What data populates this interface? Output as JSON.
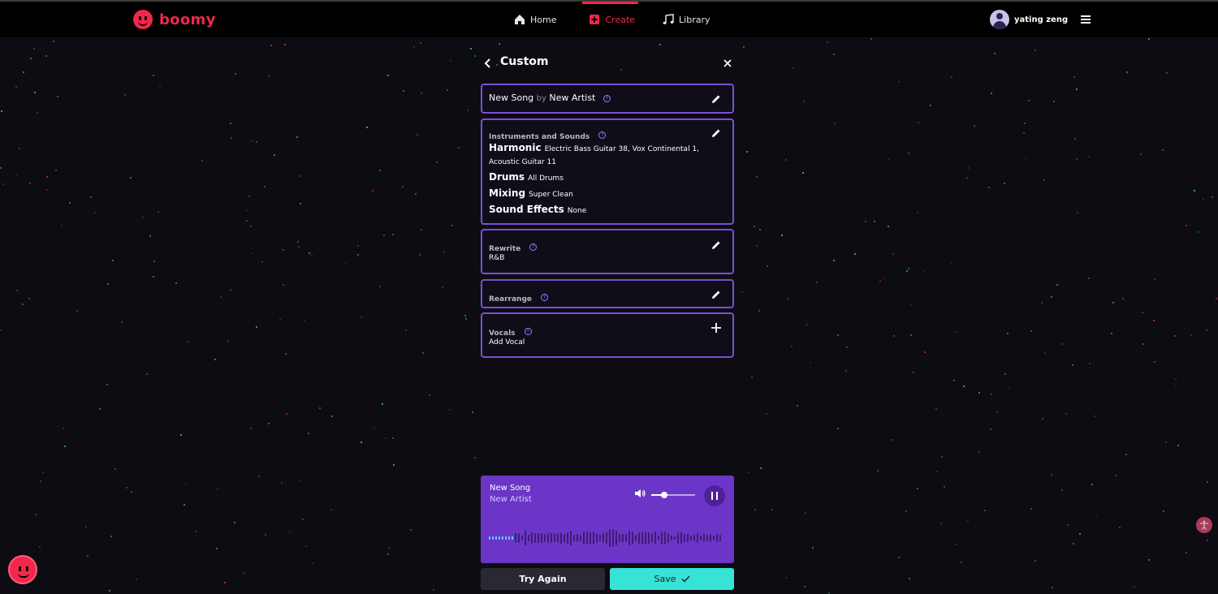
{
  "brand": {
    "name": "boomy",
    "accent": "#f0284a"
  },
  "nav": {
    "home": "Home",
    "create": "Create",
    "library": "Library"
  },
  "user": {
    "name": "yating zeng"
  },
  "panel": {
    "title": "Custom",
    "song": {
      "title": "New Song",
      "by": "by",
      "artist": "New Artist"
    },
    "instruments": {
      "label": "Instruments and Sounds",
      "rows": [
        {
          "name": "Harmonic",
          "value": "Electric Bass Guitar 38, Vox Continental 1, Acoustic Guitar 11"
        },
        {
          "name": "Drums",
          "value": "All Drums"
        },
        {
          "name": "Mixing",
          "value": "Super Clean"
        },
        {
          "name": "Sound Effects",
          "value": "None"
        }
      ]
    },
    "rewrite": {
      "label": "Rewrite",
      "value": "R&B"
    },
    "rearrange": {
      "label": "Rearrange"
    },
    "vocals": {
      "label": "Vocals",
      "value": "Add Vocal"
    }
  },
  "player": {
    "title": "New Song",
    "artist": "New Artist",
    "volume": 0.3,
    "progress": 0.11,
    "state": "playing"
  },
  "actions": {
    "try_again": "Try Again",
    "save": "Save"
  },
  "colors": {
    "card_border": "#7a4fd6",
    "player_bg": "#6b36c7",
    "save_bg": "#36e3d6"
  }
}
